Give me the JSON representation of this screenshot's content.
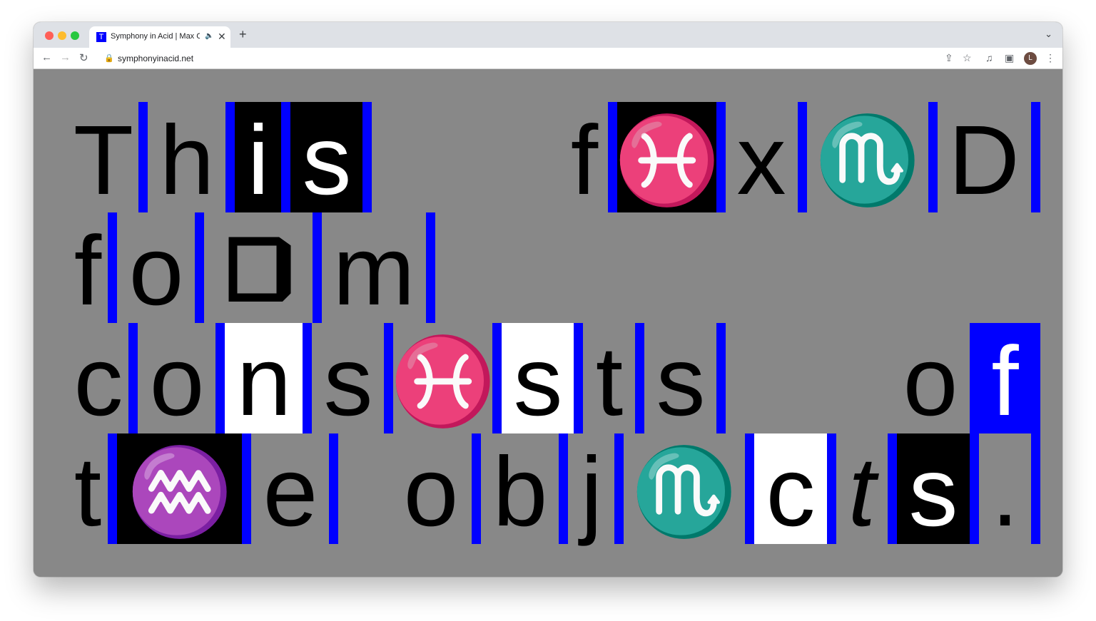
{
  "browser": {
    "tab": {
      "title": "Symphony in Acid | Max Co",
      "favicon_letter": "T",
      "audio_icon": "speaker-icon",
      "close_glyph": "✕"
    },
    "new_tab_glyph": "+",
    "tab_search_glyph": "⌄",
    "url": "symphonyinacid.net",
    "avatar_letter": "L"
  },
  "colors": {
    "accent_blue": "#0000ff",
    "page_background": "#888888",
    "text": "#000000"
  },
  "letters": {
    "row1": [
      "T",
      "h",
      "i",
      "s",
      "f",
      "♓",
      "x",
      "♏",
      "D"
    ],
    "row2": [
      "f",
      "o",
      "⛋",
      "m"
    ],
    "row3": [
      "c",
      "o",
      "n",
      "s",
      "♓",
      "s",
      "t",
      "s",
      "o",
      "f"
    ],
    "row4": [
      "t",
      "♒",
      "e",
      "o",
      "b",
      "j",
      "♏",
      "c",
      "t",
      "s",
      "."
    ]
  }
}
